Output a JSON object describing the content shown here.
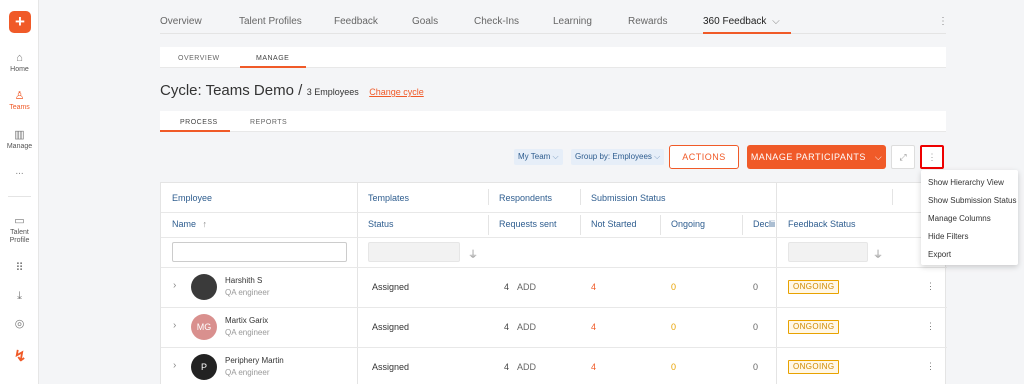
{
  "rail": {
    "items": [
      {
        "label": "Home",
        "icon": "home-icon",
        "glyph": "⌂"
      },
      {
        "label": "Teams",
        "icon": "teams-icon",
        "glyph": "♙"
      },
      {
        "label": "Manage",
        "icon": "building-icon",
        "glyph": "▥"
      },
      {
        "label": "...",
        "icon": "more-icon",
        "glyph": ""
      },
      {
        "label": "Talent Profile",
        "icon": "id-card-icon",
        "glyph": "▭"
      },
      {
        "label": "",
        "icon": "apps-grid-icon",
        "glyph": "⠿"
      },
      {
        "label": "",
        "icon": "download-icon",
        "glyph": "⤓"
      },
      {
        "label": "",
        "icon": "target-icon",
        "glyph": "◎"
      }
    ]
  },
  "topnav": {
    "tabs": [
      "Overview",
      "Talent Profiles",
      "Feedback",
      "Goals",
      "Check-Ins",
      "Learning",
      "Rewards",
      "360 Feedback"
    ],
    "active_chevron": "⌵"
  },
  "subtabs": {
    "overview": "OVERVIEW",
    "manage": "MANAGE"
  },
  "cycle": {
    "title": "Cycle: Teams Demo /",
    "count": "3 Employees",
    "change_link": "Change cycle"
  },
  "process_tabs": {
    "process": "PROCESS",
    "reports": "REPORTS"
  },
  "toolbar": {
    "my_team": "My Team",
    "group_by": "Group by: Employees",
    "actions": "ACTIONS",
    "manage_participants": "MANAGE PARTICIPANTS",
    "chevron": "⌵"
  },
  "table": {
    "group_headers": {
      "employee": "Employee",
      "templates": "Templates",
      "respondents": "Respondents",
      "submission_status": "Submission Status"
    },
    "columns": {
      "name": "Name",
      "sort_arrow": "↑",
      "status": "Status",
      "requests_sent": "Requests sent",
      "not_started": "Not Started",
      "ongoing": "Ongoing",
      "declined": "Declii",
      "feedback_status": "Feedback Status"
    },
    "rows": [
      {
        "name": "Harshith S",
        "role": "QA engineer",
        "avatar": "",
        "avatar_color": "#3a3a3a",
        "status": "Assigned",
        "requests_sent": "4",
        "add": "ADD",
        "not_started": "4",
        "ongoing": "0",
        "declined": "0",
        "feedback_status": "ONGOING"
      },
      {
        "name": "Martix Garix",
        "role": "QA engineer",
        "avatar": "MG",
        "avatar_color": "#d9908e",
        "status": "Assigned",
        "requests_sent": "4",
        "add": "ADD",
        "not_started": "4",
        "ongoing": "0",
        "declined": "0",
        "feedback_status": "ONGOING"
      },
      {
        "name": "Periphery Martin",
        "role": "QA engineer",
        "avatar": "P",
        "avatar_color": "#222222",
        "status": "Assigned",
        "requests_sent": "4",
        "add": "ADD",
        "not_started": "4",
        "ongoing": "0",
        "declined": "0",
        "feedback_status": "ONGOING"
      }
    ]
  },
  "menu": {
    "items": [
      "Show Hierarchy View",
      "Show Submission Status",
      "Manage Columns",
      "Hide Filters",
      "Export"
    ]
  },
  "colors": {
    "accent": "#f05a28",
    "link_blue": "#2e5d8f",
    "ongoing": "#e8a200"
  }
}
